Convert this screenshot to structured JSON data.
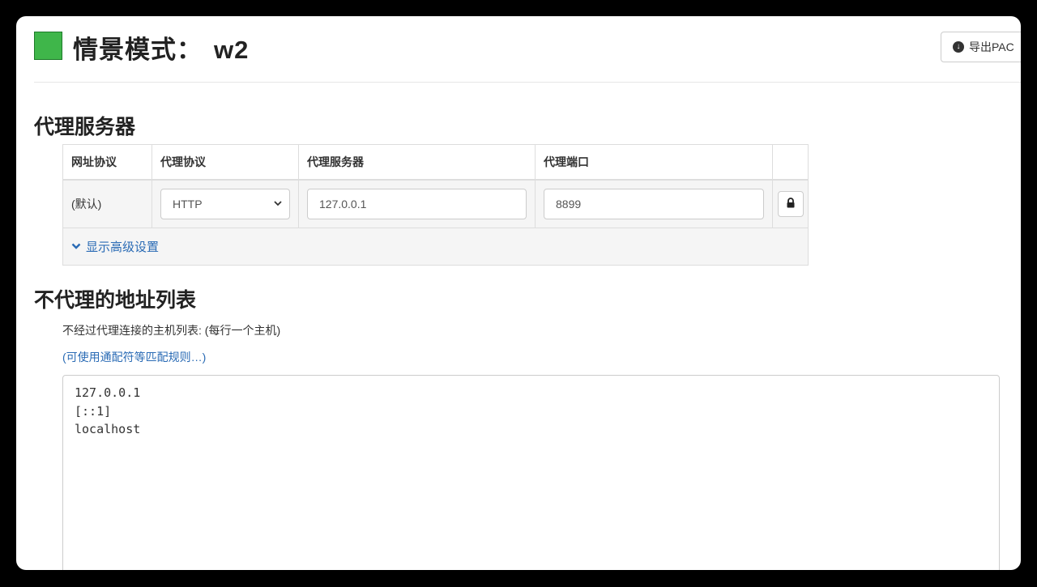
{
  "header": {
    "title_prefix": "情景模式：",
    "profile_name": "w2",
    "profile_color": "#3fb64a",
    "export_label": "导出PAC",
    "export_icon": "download-circle-icon"
  },
  "proxy_section": {
    "heading": "代理服务器",
    "columns": [
      "网址协议",
      "代理协议",
      "代理服务器",
      "代理端口"
    ],
    "row": {
      "scheme": "(默认)",
      "protocol": "HTTP",
      "server": "127.0.0.1",
      "port": "8899",
      "lock_icon": "lock-icon"
    },
    "advanced_label": "显示高级设置"
  },
  "bypass_section": {
    "heading": "不代理的地址列表",
    "description": "不经过代理连接的主机列表: (每行一个主机)",
    "help_link": "(可使用通配符等匹配规则…)",
    "entries": [
      "127.0.0.1",
      "[::1]",
      "localhost"
    ]
  }
}
